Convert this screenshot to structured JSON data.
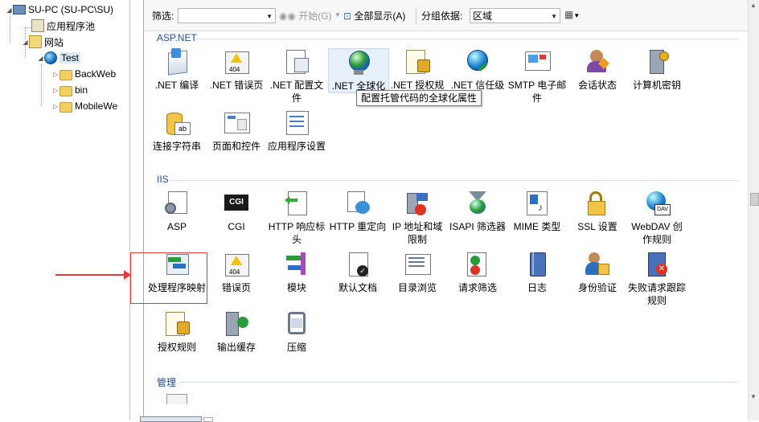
{
  "tree": {
    "server": "SU-PC (SU-PC\\SU)",
    "app_pools": "应用程序池",
    "sites": "网站",
    "site_test": "Test",
    "folders": [
      "BackWeb",
      "bin",
      "MobileWe"
    ]
  },
  "toolbar": {
    "filter_label": "筛选:",
    "filter_value": "",
    "start_label": "开始(G)",
    "show_all_label": "全部显示(A)",
    "group_by_label": "分组依据:",
    "group_by_value": "区域"
  },
  "sections": {
    "aspnet": {
      "title": "ASP.NET",
      "items": [
        ".NET 编译",
        ".NET 错误页",
        ".NET 配置文件",
        ".NET 全球化",
        ".NET 授权规",
        ".NET 信任级",
        "SMTP 电子邮件",
        "会话状态",
        "计算机密钥",
        "连接字符串",
        "页面和控件",
        "应用程序设置"
      ]
    },
    "iis": {
      "title": "IIS",
      "items": [
        "ASP",
        "CGI",
        "HTTP 响应标头",
        "HTTP 重定向",
        "IP 地址和域限制",
        "ISAPI 筛选器",
        "MIME 类型",
        "SSL 设置",
        "WebDAV 创作规则",
        "处理程序映射",
        "错误页",
        "模块",
        "默认文档",
        "目录浏览",
        "请求筛选",
        "日志",
        "身份验证",
        "失败请求跟踪规则",
        "授权规则",
        "输出缓存",
        "压缩"
      ]
    },
    "manage": {
      "title": "管理"
    }
  },
  "tooltip": "配置托管代码的全球化属性",
  "colors": {
    "section_title": "#1f4e96",
    "highlight": "#e23a3a",
    "hover": "#e6f0fa"
  }
}
